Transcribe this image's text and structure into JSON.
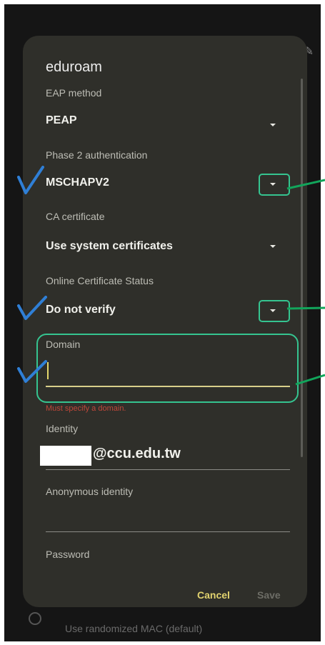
{
  "dialog": {
    "title": "eduroam",
    "eap_method": {
      "label": "EAP method",
      "value": "PEAP"
    },
    "phase2": {
      "label": "Phase 2 authentication",
      "value": "MSCHAPV2"
    },
    "ca_certificate": {
      "label": "CA certificate",
      "value": "Use system certificates"
    },
    "ocsp": {
      "label": "Online Certificate Status",
      "value": "Do not verify"
    },
    "domain": {
      "label": "Domain",
      "value": "",
      "error": "Must specify a domain."
    },
    "identity": {
      "label": "Identity",
      "value_suffix": "@ccu.edu.tw"
    },
    "anonymous_identity": {
      "label": "Anonymous identity",
      "value": ""
    },
    "password": {
      "label": "Password"
    },
    "buttons": {
      "cancel": "Cancel",
      "save": "Save"
    }
  },
  "background": {
    "mac_option": "Use randomized MAC (default)"
  },
  "colors": {
    "dialog_bg": "#2f2f2a",
    "accent_yellow": "#e2d36f",
    "callout_green": "#35c490",
    "line_green": "#12a55b",
    "check_blue": "#2f7fd6",
    "error_red": "#c0473a"
  }
}
